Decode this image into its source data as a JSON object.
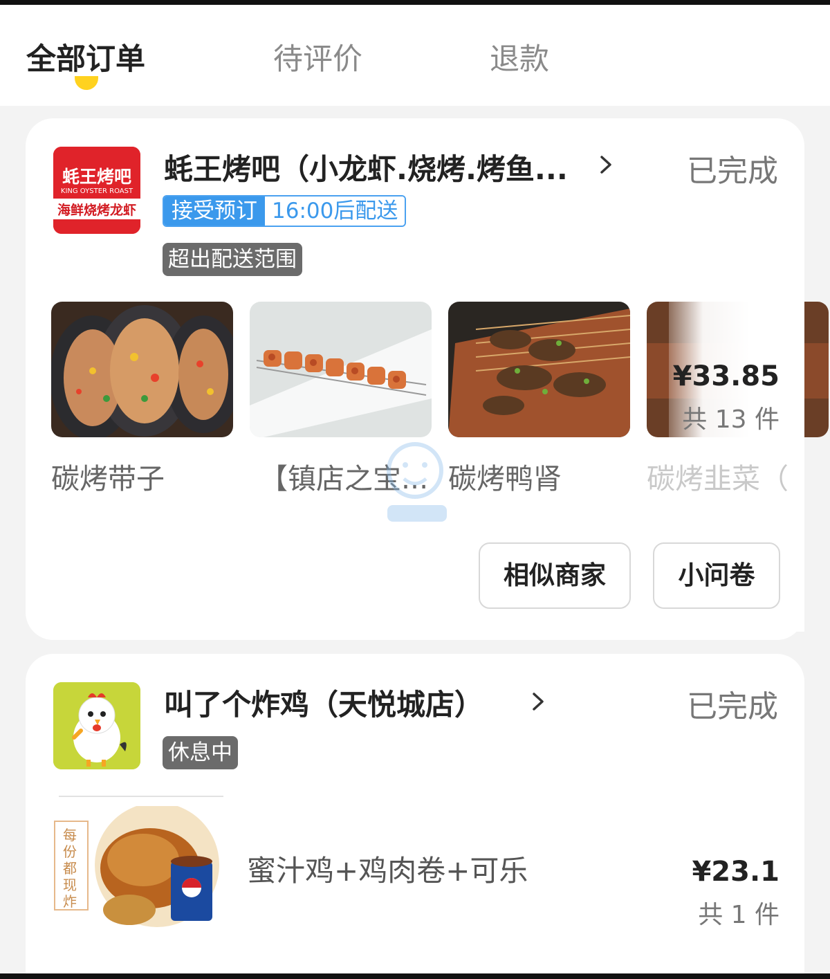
{
  "tabs": {
    "all_orders": "全部订单",
    "to_review": "待评价",
    "refund": "退款"
  },
  "order1": {
    "shop_name": "蚝王烤吧（小龙虾.烧烤.烤鱼...",
    "status": "已完成",
    "logo_text_main": "蚝王烤吧",
    "logo_text_en": "KING OYSTER ROAST",
    "logo_text_sub": "海鲜烧烤龙虾",
    "tag_booking": "接受预订",
    "tag_delivery_time": "16:00后配送",
    "tag_range": "超出配送范围",
    "items": [
      "碳烤带子",
      "【镇店之宝...",
      "碳烤鸭肾",
      "碳烤韭菜（"
    ],
    "price": "¥33.85",
    "count": "共 13 件",
    "buttons": {
      "similar": "相似商家",
      "survey": "小问卷"
    }
  },
  "order2": {
    "shop_name": "叫了个炸鸡（天悦城店）",
    "status": "已完成",
    "tag_resting": "休息中",
    "combo_name": "蜜汁鸡+鸡肉卷+可乐",
    "combo_side_text": "每份都现炸",
    "price": "¥23.1",
    "count": "共 1 件"
  },
  "colors": {
    "accent_yellow": "#ffd21f",
    "tag_blue": "#3b99ec",
    "logo_red": "#e0232a",
    "logo_green": "#c7d63a"
  }
}
